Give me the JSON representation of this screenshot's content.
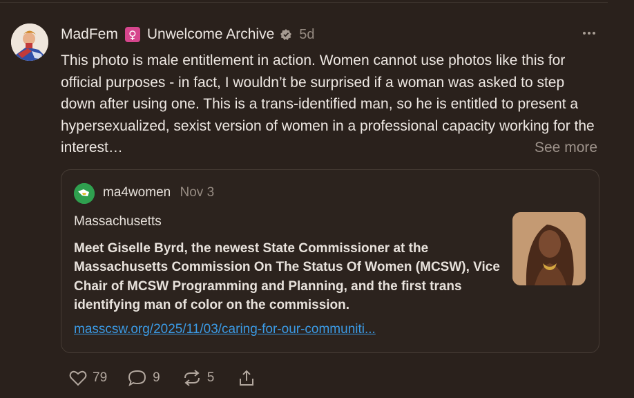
{
  "post": {
    "author": "MadFem",
    "female_symbol": "♀",
    "display_name": "Unwelcome Archive",
    "time": "5d",
    "body": "This photo is male entitlement in action. Women cannot use photos like this for official purposes - in fact, I wouldn’t be surprised if a woman was asked to step down after using one. This is a trans-identified man, so he is entitled to present a hypersexualized, sexist version of women in a professional capacity working for the interest…",
    "see_more": "See more"
  },
  "quote": {
    "author": "ma4women",
    "date": "Nov 3",
    "location": "Massachusetts",
    "body": "Meet Giselle Byrd, the newest State Commissioner at the Massachusetts Commission On The Status Of Women (MCSW), Vice Chair of MCSW Programming and Planning, and the first trans identifying man of color on the commission.",
    "link": "masscsw.org/2025/11/03/caring-for-our-communiti..."
  },
  "actions": {
    "likes": "79",
    "replies": "9",
    "reposts": "5"
  },
  "icons": [
    "profile-avatar",
    "female-symbol-icon",
    "verified-icon",
    "more-icon",
    "heart-icon",
    "comment-icon",
    "repost-icon",
    "share-icon"
  ],
  "colors": {
    "background": "#2a211c",
    "text": "#eee8e3",
    "muted": "#968b82",
    "link": "#3b9be6",
    "badge": "#d6468d"
  }
}
